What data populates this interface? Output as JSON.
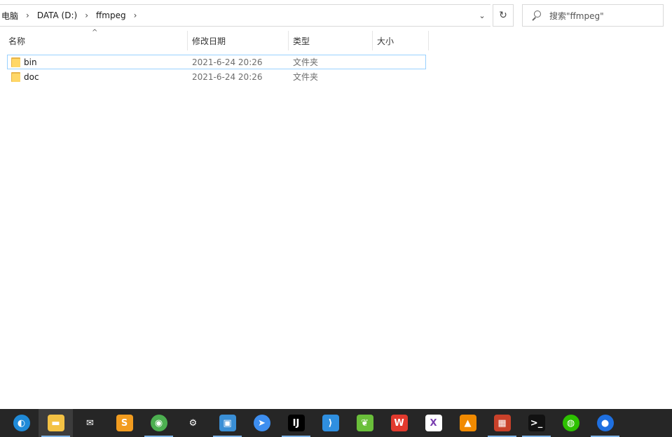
{
  "breadcrumb": {
    "items": [
      "电脑",
      "DATA (D:)",
      "ffmpeg"
    ]
  },
  "address": {
    "dropdown_glyph": "⌄",
    "refresh_glyph": "↻"
  },
  "search": {
    "placeholder": "搜索\"ffmpeg\""
  },
  "columns": {
    "name": "名称",
    "date": "修改日期",
    "type": "类型",
    "size": "大小",
    "sort_glyph": "^"
  },
  "files": [
    {
      "name": "bin",
      "date": "2021-6-24 20:26",
      "type": "文件夹"
    },
    {
      "name": "doc",
      "date": "2021-6-24 20:26",
      "type": "文件夹"
    }
  ],
  "taskbar": {
    "apps": [
      {
        "icon": "edge-icon",
        "color": "#1f8ad8",
        "running": false
      },
      {
        "icon": "file-explorer-icon",
        "color": "#f4c244",
        "running": true,
        "active": true
      },
      {
        "icon": "mail-icon",
        "color": "#ffffff",
        "running": false
      },
      {
        "icon": "sublime-text-icon",
        "color": "#f29c1f",
        "running": false
      },
      {
        "icon": "chrome-icon",
        "color": "#4caf50",
        "running": true
      },
      {
        "icon": "settings-gear-icon",
        "color": "#ffffff",
        "running": false
      },
      {
        "icon": "remote-desktop-icon",
        "color": "#3a8fd6",
        "running": true
      },
      {
        "icon": "feishu-icon",
        "color": "#3d8ef0",
        "running": false
      },
      {
        "icon": "intellij-idea-icon",
        "color": "#000000",
        "running": true
      },
      {
        "icon": "vscode-icon",
        "color": "#2f8fe0",
        "running": false
      },
      {
        "icon": "green-leaf-app-icon",
        "color": "#6abf3a",
        "running": false
      },
      {
        "icon": "wps-office-icon",
        "color": "#e23a2e",
        "running": false
      },
      {
        "icon": "xmind-icon",
        "color": "#ffffff",
        "running": false
      },
      {
        "icon": "vlc-icon",
        "color": "#f18a00",
        "running": false
      },
      {
        "icon": "package-box-icon",
        "color": "#c9412a",
        "running": true
      },
      {
        "icon": "terminal-icon",
        "color": "#111111",
        "running": true
      },
      {
        "icon": "wechat-icon",
        "color": "#2dc100",
        "running": false
      },
      {
        "icon": "map-pin-app-icon",
        "color": "#1e6fe0",
        "running": true
      }
    ]
  }
}
